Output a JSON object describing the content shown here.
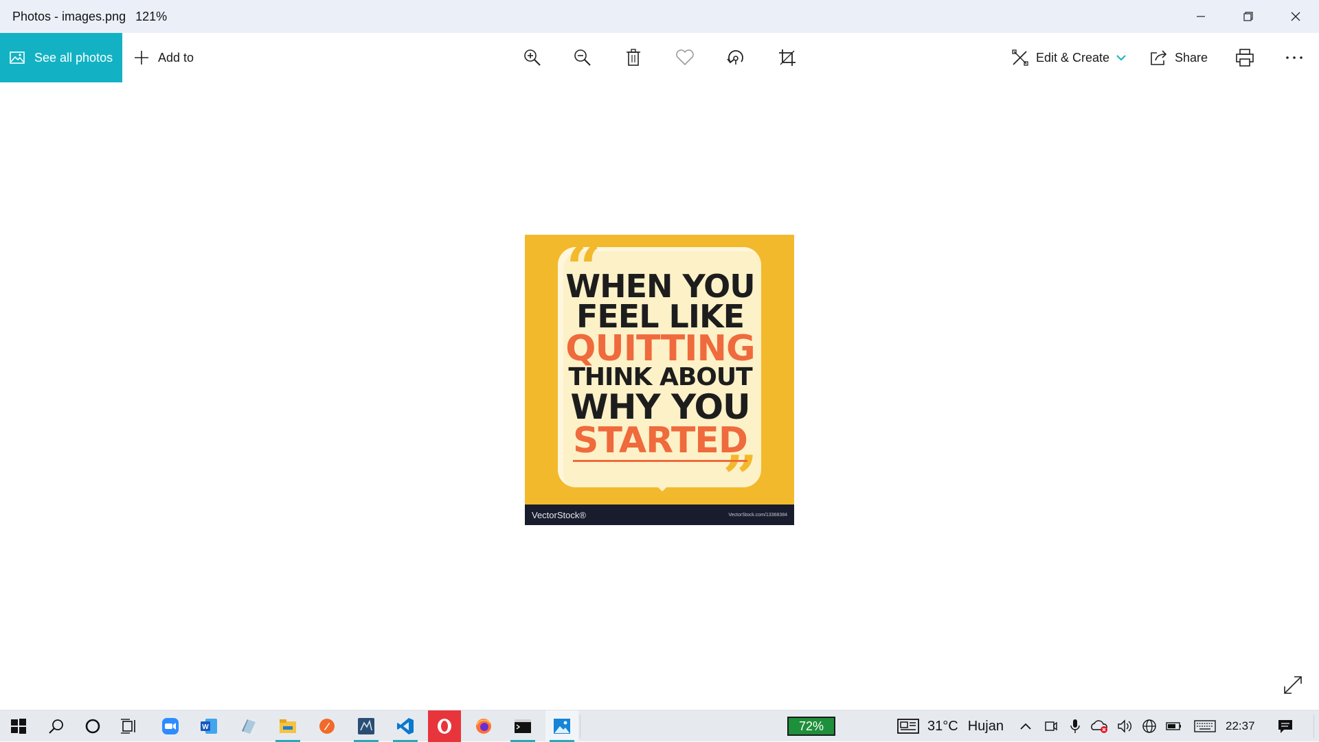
{
  "window": {
    "title": "Photos - images.png",
    "zoom_level": "121%",
    "minimize_icon": "minimize-icon",
    "restore_icon": "restore-icon",
    "close_icon": "close-icon"
  },
  "toolbar": {
    "see_all_label": "See all photos",
    "add_to_label": "Add to",
    "tools": [
      "zoom-in-icon",
      "zoom-out-icon",
      "delete-icon",
      "favorite-heart-icon",
      "rotate-icon",
      "crop-icon"
    ],
    "edit_create_label": "Edit & Create",
    "share_label": "Share",
    "print_icon": "print-icon",
    "more_icon": "more-icon",
    "accent_color": "#12b2c4"
  },
  "image": {
    "quote_lines": [
      {
        "text": "WHEN YOU",
        "color": "#1d1d1d"
      },
      {
        "text": "FEEL LIKE",
        "color": "#1d1d1d"
      },
      {
        "text": "QUITTING",
        "color": "#ef6a3c"
      },
      {
        "text": "THINK ABOUT",
        "color": "#1d1d1d"
      },
      {
        "text": "WHY YOU",
        "color": "#1d1d1d"
      },
      {
        "text": "STARTED",
        "color": "#ef6a3c"
      }
    ],
    "watermark_brand": "VectorStock®",
    "watermark_url": "VectorStock.com/13368384",
    "background_color": "#f3b92c",
    "bubble_color": "#fdf1c8"
  },
  "canvas": {
    "fullscreen_icon": "expand-icon"
  },
  "taskbar": {
    "apps": [
      "windows-start-icon",
      "search-icon",
      "cortana-icon",
      "task-view-icon",
      "zoom-app-icon",
      "word-app-icon",
      "notes-app-icon",
      "file-explorer-icon",
      "brave-app-icon",
      "mysql-workbench-icon",
      "vscode-icon",
      "opera-icon",
      "firefox-icon",
      "terminal-icon",
      "photos-app-icon"
    ],
    "battery_widget": "72%",
    "weather_temp": "31°C",
    "weather_condition": "Hujan",
    "clock": "22:37"
  }
}
